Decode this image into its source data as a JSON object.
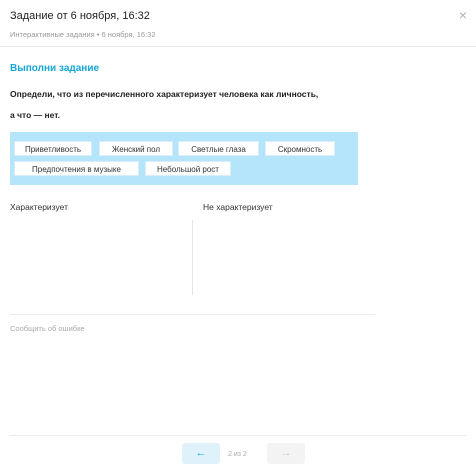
{
  "header": {
    "title": "Задание от 6 ноября, 16:32",
    "subtitle": "Интерактивные задания • 6 ноября, 16:32",
    "close_glyph": "×"
  },
  "task": {
    "heading": "Выполни задание",
    "question_line1": "Определи, что из перечисленного характеризует человека как личность,",
    "question_line2": "а что — нет."
  },
  "chips": [
    "Приветливость",
    "Женский пол",
    "Светлые глаза",
    "Скромность",
    "Предпочтения в музыке",
    "Небольшой рост"
  ],
  "columns": {
    "left_label": "Характеризует",
    "right_label": "Не характеризует"
  },
  "footer": {
    "report_label": "Сообщить об ошибке",
    "prev_glyph": "←",
    "next_glyph": "→",
    "page_indicator": "2 из 2"
  },
  "colors": {
    "accent": "#16a6d6",
    "chip_area": "#b4e5fb"
  },
  "icons": {
    "close": "close-icon",
    "prev": "arrow-left-icon",
    "next": "arrow-right-icon"
  }
}
